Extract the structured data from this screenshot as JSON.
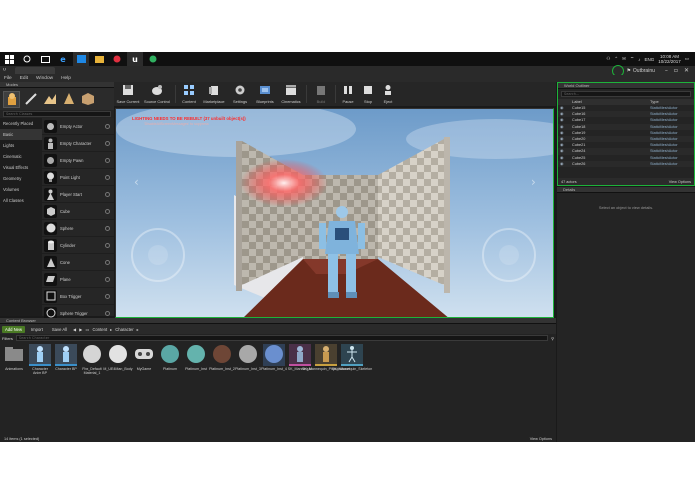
{
  "taskbar": {
    "time": "10:08 AM",
    "date": "10/22/2017",
    "lang": "ENG"
  },
  "app": {
    "user": "Outbrainu"
  },
  "menu": [
    "File",
    "Edit",
    "Window",
    "Help"
  ],
  "modes": {
    "tab_label": "Modes",
    "search_placeholder": "Search Classes",
    "categories": [
      "Recently Placed",
      "Basic",
      "Lights",
      "Cinematic",
      "Visual Effects",
      "Geometry",
      "Volumes",
      "All Classes"
    ],
    "active_category": "Basic",
    "actors": [
      {
        "name": "Empty Actor",
        "icon": "sphere-small"
      },
      {
        "name": "Empty Character",
        "icon": "character"
      },
      {
        "name": "Empty Pawn",
        "icon": "pawn"
      },
      {
        "name": "Point Light",
        "icon": "bulb"
      },
      {
        "name": "Player Start",
        "icon": "player"
      },
      {
        "name": "Cube",
        "icon": "cube"
      },
      {
        "name": "Sphere",
        "icon": "sphere"
      },
      {
        "name": "Cylinder",
        "icon": "cylinder"
      },
      {
        "name": "Cone",
        "icon": "cone"
      },
      {
        "name": "Plane",
        "icon": "plane"
      },
      {
        "name": "Box Trigger",
        "icon": "box"
      },
      {
        "name": "Sphere Trigger",
        "icon": "sphere-trigger"
      }
    ]
  },
  "toolbar": {
    "items": [
      {
        "label": "Save Current",
        "icon": "save-icon"
      },
      {
        "label": "Source Control",
        "icon": "source-control-icon"
      },
      {
        "label": "Content",
        "icon": "content-icon"
      },
      {
        "label": "Marketplace",
        "icon": "marketplace-icon"
      },
      {
        "label": "Settings",
        "icon": "settings-icon"
      },
      {
        "label": "Blueprints",
        "icon": "blueprints-icon"
      },
      {
        "label": "Cinematics",
        "icon": "cinematics-icon"
      },
      {
        "label": "Build",
        "icon": "build-icon"
      },
      {
        "label": "Pause",
        "icon": "pause-icon"
      },
      {
        "label": "Stop",
        "icon": "stop-icon"
      },
      {
        "label": "Eject",
        "icon": "eject-icon"
      }
    ]
  },
  "viewport": {
    "warning": "LIGHTING NEEDS TO BE REBUILT (37 unbuilt object(s))",
    "sub": "'DisableAllScreenMessages' to suppress"
  },
  "outliner": {
    "tab_label": "World Outliner",
    "search_placeholder": "Search...",
    "col_label": "Label",
    "col_type": "Type",
    "rows": [
      {
        "label": "Cube15",
        "type": "StaticMeshActor"
      },
      {
        "label": "Cube16",
        "type": "StaticMeshActor"
      },
      {
        "label": "Cube17",
        "type": "StaticMeshActor"
      },
      {
        "label": "Cube18",
        "type": "StaticMeshActor"
      },
      {
        "label": "Cube19",
        "type": "StaticMeshActor"
      },
      {
        "label": "Cube20",
        "type": "StaticMeshActor"
      },
      {
        "label": "Cube21",
        "type": "StaticMeshActor"
      },
      {
        "label": "Cube24",
        "type": "StaticMeshActor"
      },
      {
        "label": "Cube25",
        "type": "StaticMeshActor"
      },
      {
        "label": "Cube26",
        "type": "StaticMeshActor"
      }
    ],
    "actor_count": "47 actors",
    "view_options": "View Options"
  },
  "details": {
    "tab_label": "Details",
    "empty_text": "Select an object to view details."
  },
  "content_browser": {
    "tab_label": "Content Browser",
    "add_new": "Add New",
    "import": "Import",
    "save_all": "Save All",
    "crumbs": [
      "Content",
      "Character"
    ],
    "filters": "Filters",
    "search_placeholder": "Search Character",
    "assets": [
      {
        "name": "Animations",
        "kind": "folder",
        "color": "#888888"
      },
      {
        "name": "Character Anim BP",
        "kind": "char",
        "color": "#3a8fc9"
      },
      {
        "name": "Character BP",
        "kind": "char",
        "color": "#3a8fc9"
      },
      {
        "name": "Fbx_Default Material_1",
        "kind": "sphere-white",
        "color": "#cccccc"
      },
      {
        "name": "M_UE4Man_Body",
        "kind": "sphere-white",
        "color": "#cccccc"
      },
      {
        "name": "MyGame",
        "kind": "gamepad",
        "color": "#cccccc"
      },
      {
        "name": "Platinum",
        "kind": "sphere-teal",
        "color": "#7fb09a"
      },
      {
        "name": "Platinum_Inst",
        "kind": "sphere-teal",
        "color": "#7fb09a"
      },
      {
        "name": "Platinum_Inst_2",
        "kind": "sphere-dark",
        "color": "#7a4e3a"
      },
      {
        "name": "Platinum_Inst_3",
        "kind": "sphere-grey",
        "color": "#9a9a9a"
      },
      {
        "name": "Platinum_Inst_4",
        "kind": "sphere-blue",
        "color": "#4f6fb0"
      },
      {
        "name": "SK_Mannequin",
        "kind": "mesh-pink",
        "color": "#c050a0"
      },
      {
        "name": "SK_Mannequin_PhysicsAsset",
        "kind": "physics",
        "color": "#c8a040"
      },
      {
        "name": "SK_Mannequin_Skeleton",
        "kind": "skeleton",
        "color": "#50a0c0"
      }
    ],
    "status": "14 items (1 selected)",
    "view_options": "View Options"
  }
}
